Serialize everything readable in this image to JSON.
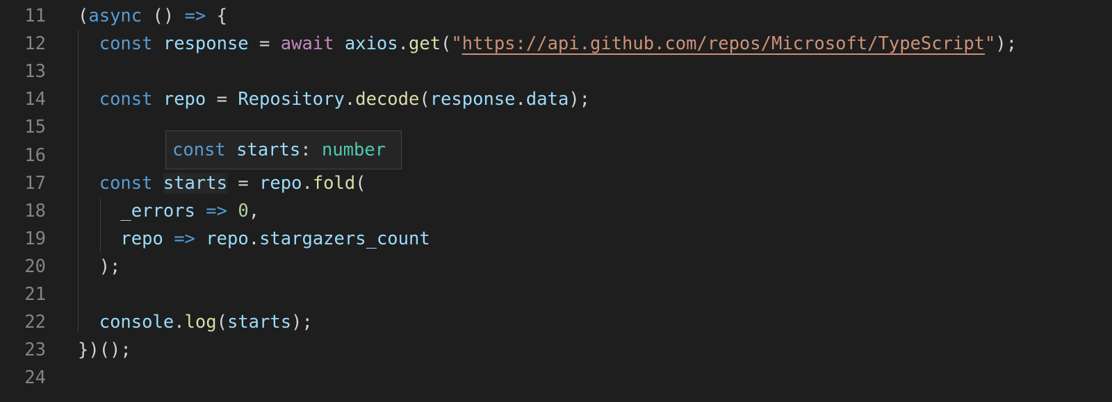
{
  "editor": {
    "lines": [
      {
        "number": "11",
        "tokens": [
          {
            "text": "(",
            "color": "#d4d4d4"
          },
          {
            "text": "async",
            "color": "#569cd6"
          },
          {
            "text": " () ",
            "color": "#d4d4d4"
          },
          {
            "text": "=>",
            "color": "#569cd6"
          },
          {
            "text": " {",
            "color": "#d4d4d4"
          }
        ]
      },
      {
        "number": "12",
        "tokens": [
          {
            "text": "  ",
            "color": "#d4d4d4"
          },
          {
            "text": "const",
            "color": "#569cd6"
          },
          {
            "text": " ",
            "color": "#d4d4d4"
          },
          {
            "text": "response",
            "color": "#9cdcfe"
          },
          {
            "text": " = ",
            "color": "#d4d4d4"
          },
          {
            "text": "await",
            "color": "#c586c0"
          },
          {
            "text": " ",
            "color": "#d4d4d4"
          },
          {
            "text": "axios",
            "color": "#9cdcfe"
          },
          {
            "text": ".",
            "color": "#d4d4d4"
          },
          {
            "text": "get",
            "color": "#dcdcaa"
          },
          {
            "text": "(",
            "color": "#d4d4d4"
          },
          {
            "text": "\"",
            "color": "#ce9178"
          },
          {
            "text": "https://api.github.com/repos/Microsoft/TypeScript",
            "color": "#ce9178",
            "link": true
          },
          {
            "text": "\"",
            "color": "#ce9178"
          },
          {
            "text": ");",
            "color": "#d4d4d4"
          }
        ]
      },
      {
        "number": "13",
        "tokens": []
      },
      {
        "number": "14",
        "tokens": [
          {
            "text": "  ",
            "color": "#d4d4d4"
          },
          {
            "text": "const",
            "color": "#569cd6"
          },
          {
            "text": " ",
            "color": "#d4d4d4"
          },
          {
            "text": "repo",
            "color": "#9cdcfe"
          },
          {
            "text": " = ",
            "color": "#d4d4d4"
          },
          {
            "text": "Repository",
            "color": "#9cdcfe"
          },
          {
            "text": ".",
            "color": "#d4d4d4"
          },
          {
            "text": "decode",
            "color": "#dcdcaa"
          },
          {
            "text": "(",
            "color": "#d4d4d4"
          },
          {
            "text": "response",
            "color": "#9cdcfe"
          },
          {
            "text": ".",
            "color": "#d4d4d4"
          },
          {
            "text": "data",
            "color": "#9cdcfe"
          },
          {
            "text": ");",
            "color": "#d4d4d4"
          }
        ]
      },
      {
        "number": "15",
        "tokens": []
      },
      {
        "number": "16",
        "tokens": []
      },
      {
        "number": "17",
        "tokens": [
          {
            "text": "  ",
            "color": "#d4d4d4"
          },
          {
            "text": "const",
            "color": "#569cd6"
          },
          {
            "text": " ",
            "color": "#d4d4d4"
          },
          {
            "text": "starts",
            "color": "#9cdcfe",
            "hovered": true
          },
          {
            "text": " = ",
            "color": "#d4d4d4"
          },
          {
            "text": "repo",
            "color": "#9cdcfe"
          },
          {
            "text": ".",
            "color": "#d4d4d4"
          },
          {
            "text": "fold",
            "color": "#dcdcaa"
          },
          {
            "text": "(",
            "color": "#d4d4d4"
          }
        ]
      },
      {
        "number": "18",
        "tokens": [
          {
            "text": "    ",
            "color": "#d4d4d4"
          },
          {
            "text": "_errors",
            "color": "#9cdcfe"
          },
          {
            "text": " ",
            "color": "#d4d4d4"
          },
          {
            "text": "=>",
            "color": "#569cd6"
          },
          {
            "text": " ",
            "color": "#d4d4d4"
          },
          {
            "text": "0",
            "color": "#b5cea8"
          },
          {
            "text": ",",
            "color": "#d4d4d4"
          }
        ]
      },
      {
        "number": "19",
        "tokens": [
          {
            "text": "    ",
            "color": "#d4d4d4"
          },
          {
            "text": "repo",
            "color": "#9cdcfe"
          },
          {
            "text": " ",
            "color": "#d4d4d4"
          },
          {
            "text": "=>",
            "color": "#569cd6"
          },
          {
            "text": " ",
            "color": "#d4d4d4"
          },
          {
            "text": "repo",
            "color": "#9cdcfe"
          },
          {
            "text": ".",
            "color": "#d4d4d4"
          },
          {
            "text": "stargazers_count",
            "color": "#9cdcfe"
          }
        ]
      },
      {
        "number": "20",
        "tokens": [
          {
            "text": "  );",
            "color": "#d4d4d4"
          }
        ]
      },
      {
        "number": "21",
        "tokens": []
      },
      {
        "number": "22",
        "tokens": [
          {
            "text": "  ",
            "color": "#d4d4d4"
          },
          {
            "text": "console",
            "color": "#9cdcfe"
          },
          {
            "text": ".",
            "color": "#d4d4d4"
          },
          {
            "text": "log",
            "color": "#dcdcaa"
          },
          {
            "text": "(",
            "color": "#d4d4d4"
          },
          {
            "text": "starts",
            "color": "#9cdcfe"
          },
          {
            "text": ");",
            "color": "#d4d4d4"
          }
        ]
      },
      {
        "number": "23",
        "tokens": [
          {
            "text": "})();",
            "color": "#d4d4d4"
          }
        ]
      },
      {
        "number": "24",
        "tokens": []
      }
    ]
  },
  "hover": {
    "tokens": [
      {
        "text": "const",
        "color": "#569cd6"
      },
      {
        "text": " ",
        "color": "#d4d4d4"
      },
      {
        "text": "starts",
        "color": "#9cdcfe"
      },
      {
        "text": ": ",
        "color": "#d4d4d4"
      },
      {
        "text": "number",
        "color": "#4ec9b0"
      }
    ]
  }
}
